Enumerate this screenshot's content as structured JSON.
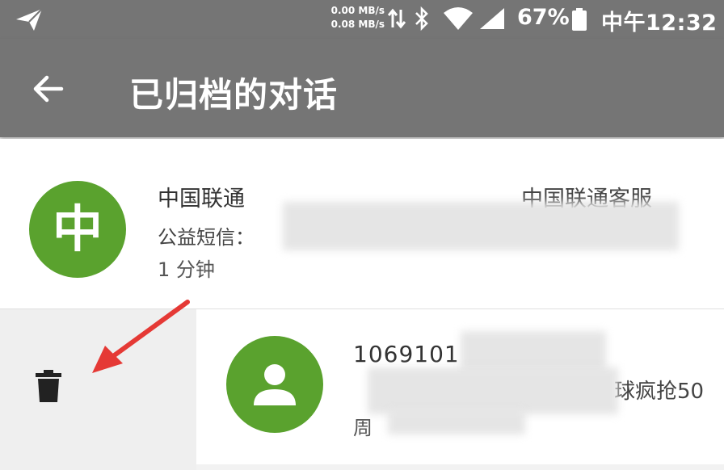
{
  "status_bar": {
    "net_speed_up": "0.00 MB/s",
    "net_speed_down": "0.08 MB/s",
    "battery": "67%",
    "time": "中午12:32",
    "icons": [
      "paper-plane-icon",
      "data-arrows-icon",
      "bluetooth-icon",
      "wifi-icon",
      "signal-icon",
      "battery-icon"
    ]
  },
  "app_bar": {
    "title": "已归档的对话",
    "back_icon": "arrow-left-icon"
  },
  "conversations": [
    {
      "avatar": "中",
      "name": "中国联通",
      "snippet": "公益短信：",
      "time": "1 分钟",
      "right_text": "中国联通客服"
    },
    {
      "avatar_icon": "person-icon",
      "name": "1069101",
      "snippet": "球疯抢50",
      "time": "周"
    }
  ],
  "swipe_action": {
    "icon": "trash-icon"
  },
  "colors": {
    "bar": "#757575",
    "avatar": "#5aa22e",
    "arrow": "#e53935"
  }
}
